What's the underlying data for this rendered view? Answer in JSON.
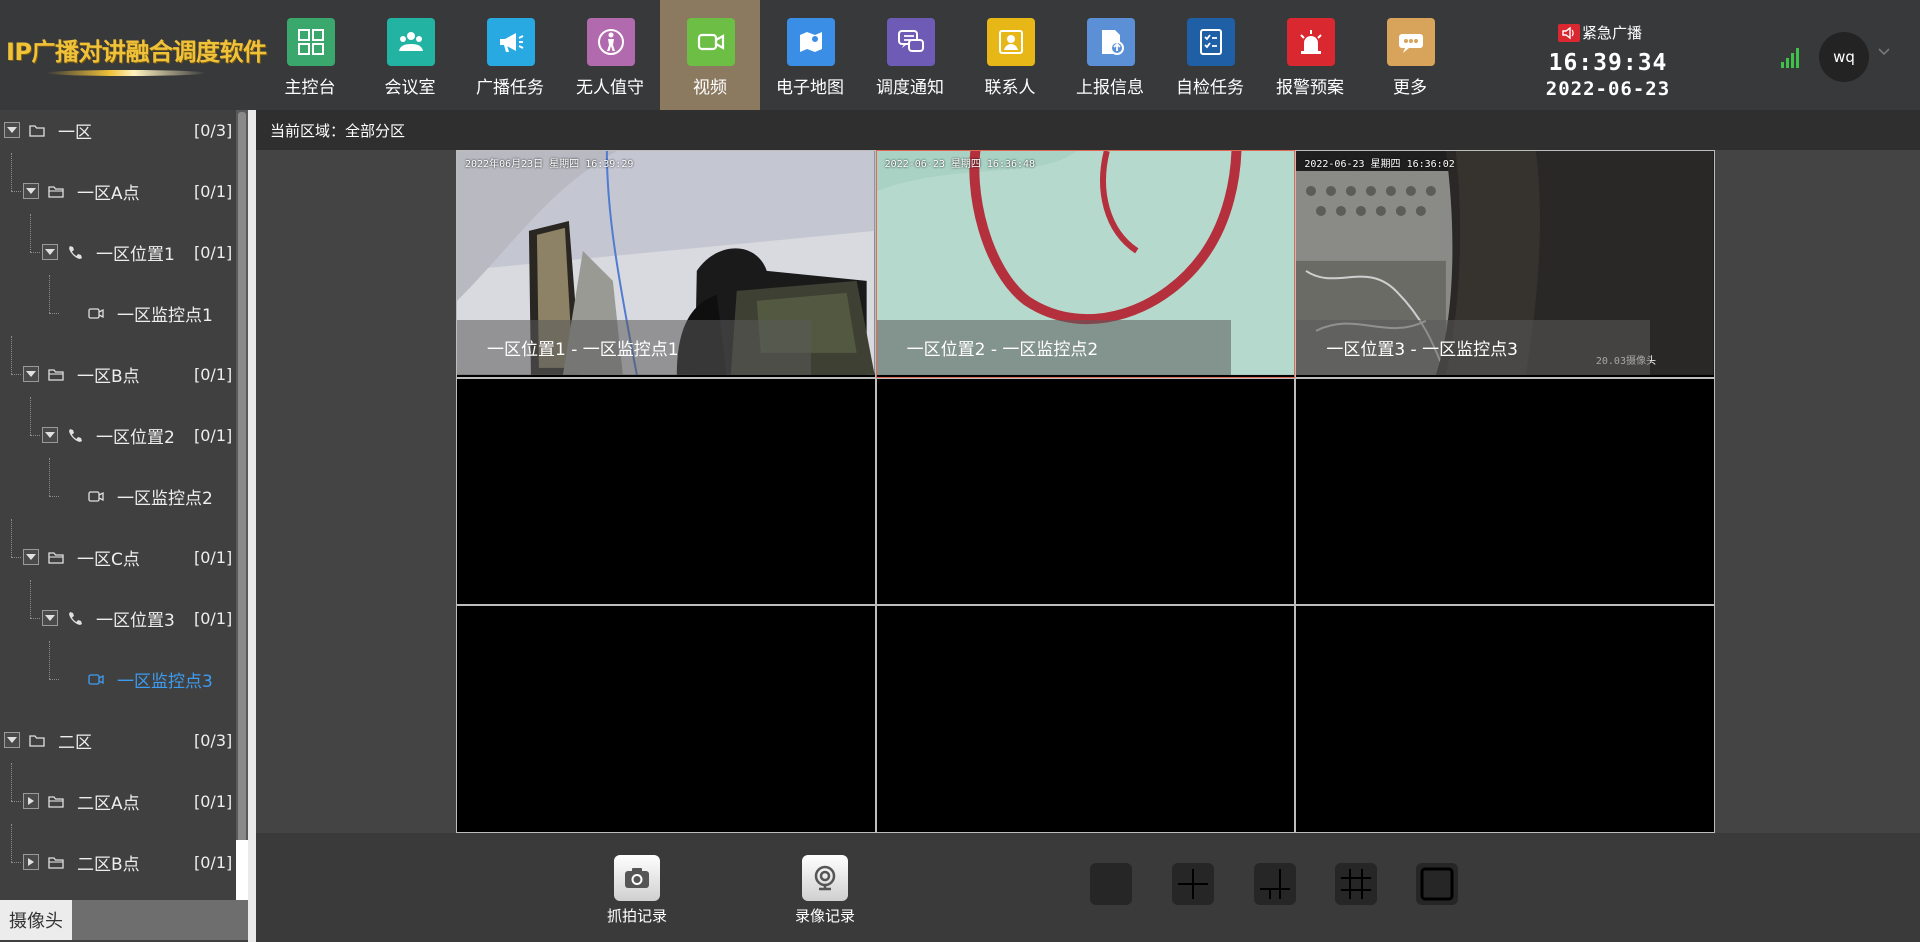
{
  "app": {
    "title": "IP广播对讲融合调度软件"
  },
  "nav": {
    "items": [
      {
        "label": "主控台",
        "icon": "dashboard-grid-icon",
        "color": "#3aa76d"
      },
      {
        "label": "会议室",
        "icon": "meeting-group-icon",
        "color": "#22b3a3"
      },
      {
        "label": "广播任务",
        "icon": "megaphone-icon",
        "color": "#29a9e1"
      },
      {
        "label": "无人值守",
        "icon": "unattended-person-icon",
        "color": "#b26aae"
      },
      {
        "label": "视频",
        "icon": "video-camera-icon",
        "color": "#6cbe45",
        "active": true
      },
      {
        "label": "电子地图",
        "icon": "map-icon",
        "color": "#3a8ee6"
      },
      {
        "label": "调度通知",
        "icon": "chat-bubbles-icon",
        "color": "#6e5bb5"
      },
      {
        "label": "联系人",
        "icon": "contact-card-icon",
        "color": "#e6b716"
      },
      {
        "label": "上报信息",
        "icon": "upload-report-icon",
        "color": "#5b8fd6"
      },
      {
        "label": "自检任务",
        "icon": "checklist-icon",
        "color": "#1f5fa6"
      },
      {
        "label": "报警预案",
        "icon": "alarm-siren-icon",
        "color": "#d9282f"
      },
      {
        "label": "更多",
        "icon": "more-dots-icon",
        "color": "#d8a35a"
      }
    ]
  },
  "header": {
    "emergency_label": "紧急广播",
    "time": "16:39:34",
    "date": "2022-06-23",
    "user": "wq"
  },
  "sidebar": {
    "tab_label": "摄像头",
    "tree": [
      {
        "label": "一区",
        "count": "[0/3]",
        "type": "zone",
        "level": 0,
        "state": "expanded"
      },
      {
        "label": "一区A点",
        "count": "[0/1]",
        "type": "folder",
        "level": 1,
        "state": "expanded"
      },
      {
        "label": "一区位置1",
        "count": "[0/1]",
        "type": "phone",
        "level": 2,
        "state": "expanded"
      },
      {
        "label": "一区监控点1",
        "count": "",
        "type": "camera",
        "level": 3
      },
      {
        "label": "一区B点",
        "count": "[0/1]",
        "type": "folder",
        "level": 1,
        "state": "expanded"
      },
      {
        "label": "一区位置2",
        "count": "[0/1]",
        "type": "phone",
        "level": 2,
        "state": "expanded"
      },
      {
        "label": "一区监控点2",
        "count": "",
        "type": "camera",
        "level": 3
      },
      {
        "label": "一区C点",
        "count": "[0/1]",
        "type": "folder",
        "level": 1,
        "state": "expanded"
      },
      {
        "label": "一区位置3",
        "count": "[0/1]",
        "type": "phone",
        "level": 2,
        "state": "expanded"
      },
      {
        "label": "一区监控点3",
        "count": "",
        "type": "camera",
        "level": 3,
        "selected": true
      },
      {
        "label": "二区",
        "count": "[0/3]",
        "type": "zone",
        "level": 0,
        "state": "expanded"
      },
      {
        "label": "二区A点",
        "count": "[0/1]",
        "type": "folder",
        "level": 1,
        "state": "collapsed"
      },
      {
        "label": "二区B点",
        "count": "[0/1]",
        "type": "folder",
        "level": 1,
        "state": "collapsed"
      }
    ]
  },
  "main": {
    "area_label": "当前区域：",
    "area_value": "全部分区",
    "area_text": "当前区域：全部分区",
    "cells": [
      {
        "caption": "一区位置1 - 一区监控点1",
        "osd": "2022年06月23日 星期四 16:39:29",
        "feed": "office-phone"
      },
      {
        "caption": "一区位置2 - 一区监控点2",
        "osd": "2022-06-23 星期四 16:36:48",
        "feed": "cable",
        "selected": true
      },
      {
        "caption": "一区位置3 - 一区监控点3",
        "osd": "2022-06-23 星期四 16:36:02",
        "feed": "equipment",
        "tag": "20.03摄像头"
      },
      {
        "caption": ""
      },
      {
        "caption": ""
      },
      {
        "caption": ""
      },
      {
        "caption": ""
      },
      {
        "caption": ""
      },
      {
        "caption": ""
      }
    ]
  },
  "toolbar": {
    "snapshot_label": "抓拍记录",
    "record_label": "录像记录",
    "layouts": [
      "layout-1x1-icon",
      "layout-2x2-icon",
      "layout-1plus5-icon",
      "layout-3x3-icon",
      "layout-fullscreen-icon"
    ]
  }
}
